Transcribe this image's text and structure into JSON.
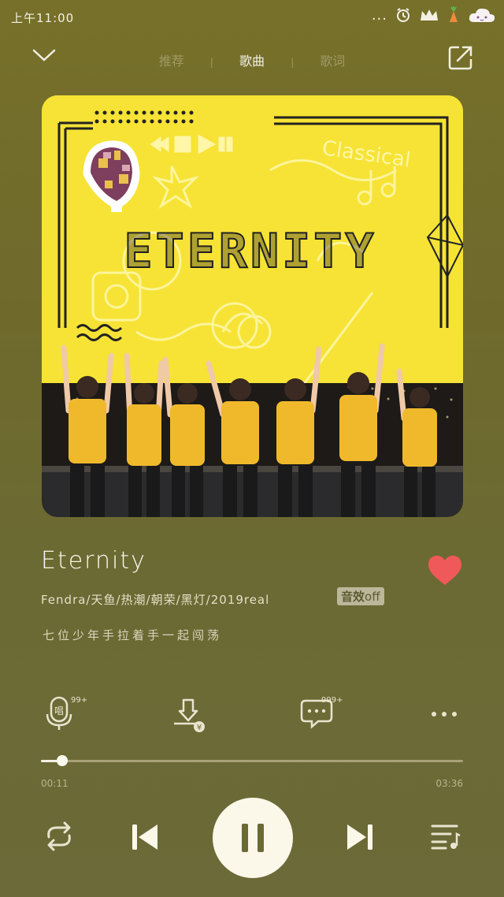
{
  "status": {
    "time": "上午11:00",
    "overflow": "..."
  },
  "nav": {
    "tabs": [
      {
        "label": "推荐",
        "active": false
      },
      {
        "label": "歌曲",
        "active": true
      },
      {
        "label": "歌词",
        "active": false
      }
    ],
    "separator": "|",
    "back_icon": "chevron-down-icon",
    "share_icon": "share-icon"
  },
  "cover": {
    "art_text": "ETERNITY",
    "decor_text": "Classical"
  },
  "song": {
    "title": "Eternity",
    "artists": "Fendra/天鱼/热潮/朝荣/黑灯/2019real",
    "fx_label": "音效",
    "fx_state": "off",
    "lyric": "七位少年手拉着手一起闯荡",
    "liked": true
  },
  "actions": {
    "sing_count": "99+",
    "comment_count": "999+"
  },
  "progress": {
    "current": "00:11",
    "total": "03:36",
    "fraction": 0.05
  },
  "colors": {
    "accent_heart": "#f0595a",
    "cover_yellow": "#f6e335",
    "background": "#706b2d"
  }
}
